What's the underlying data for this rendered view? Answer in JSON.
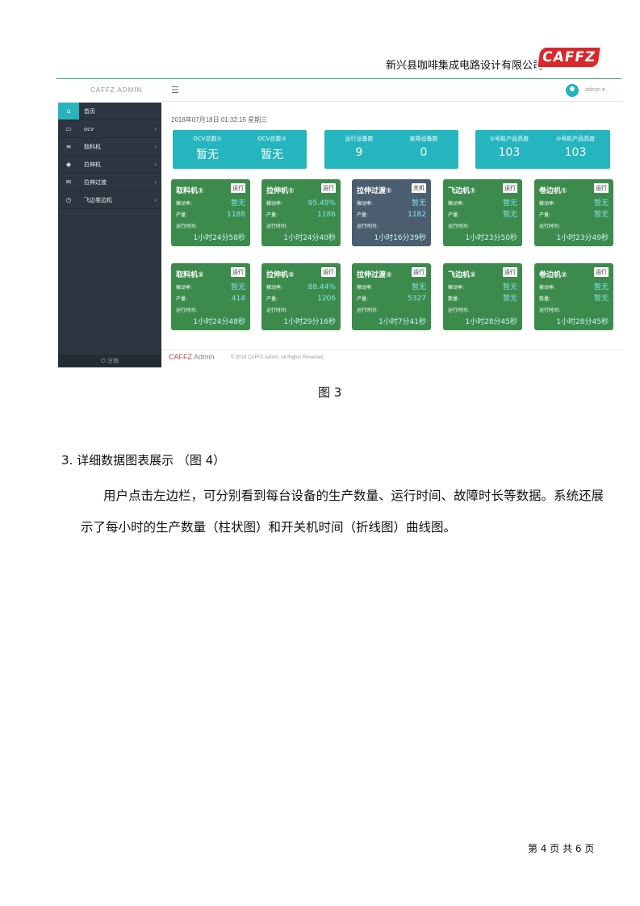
{
  "header": {
    "company": "新兴县咖啡集成电路设计有限公司",
    "logo_text": "CAFFZ"
  },
  "screenshot": {
    "brand": "CAFFZ ADMIN",
    "user": "admin ▾",
    "nav": [
      {
        "label": "首页",
        "icon": "home-icon",
        "active": true
      },
      {
        "label": "ocv",
        "icon": "monitor-icon"
      },
      {
        "label": "取料机",
        "icon": "list-icon"
      },
      {
        "label": "拉伸机",
        "icon": "tag-icon"
      },
      {
        "label": "拉伸过渡",
        "icon": "mail-icon"
      },
      {
        "label": "飞边卷边机",
        "icon": "clock-icon"
      }
    ],
    "logout": "⏻ 注销",
    "datetime": "2018年07月18日 01:32:15 星期三",
    "stats": [
      {
        "items": [
          {
            "label": "OCV总数①",
            "value": "暂无"
          },
          {
            "label": "OCV总数②",
            "value": "暂无"
          }
        ]
      },
      {
        "items": [
          {
            "label": "运行设备数",
            "value": "9"
          },
          {
            "label": "故障设备数",
            "value": "0"
          }
        ]
      },
      {
        "items": [
          {
            "label": "①号机产品高度",
            "value": "103"
          },
          {
            "label": "②号机产品高度",
            "value": "103"
          }
        ]
      }
    ],
    "devices": [
      {
        "name": "取料机①",
        "status": "运行",
        "rows": [
          {
            "k": "稼动率:",
            "v": "暂无"
          },
          {
            "k": "产量:",
            "v": "1188"
          },
          {
            "k": "运行时间:",
            "v": ""
          }
        ],
        "runtime": "1小时24分58秒"
      },
      {
        "name": "拉伸机①",
        "status": "运行",
        "rows": [
          {
            "k": "稼动率:",
            "v": "95.49%"
          },
          {
            "k": "产量:",
            "v": "1186"
          },
          {
            "k": "运行时间:",
            "v": ""
          }
        ],
        "runtime": "1小时24分40秒"
      },
      {
        "name": "拉伸过渡①",
        "status": "关机",
        "rows": [
          {
            "k": "稼动率:",
            "v": "暂无"
          },
          {
            "k": "产量:",
            "v": "1182"
          },
          {
            "k": "运行时间:",
            "v": ""
          }
        ],
        "runtime": "1小时16分39秒"
      },
      {
        "name": "飞边机①",
        "status": "运行",
        "rows": [
          {
            "k": "稼动率:",
            "v": "暂无"
          },
          {
            "k": "产量:",
            "v": "暂无"
          },
          {
            "k": "运行时间:",
            "v": ""
          }
        ],
        "runtime": "1小时23分50秒"
      },
      {
        "name": "卷边机①",
        "status": "运行",
        "rows": [
          {
            "k": "稼动率:",
            "v": "暂无"
          },
          {
            "k": "产量:",
            "v": "暂无"
          },
          {
            "k": "运行时间:",
            "v": ""
          }
        ],
        "runtime": "1小时23分49秒"
      },
      {
        "name": "取料机②",
        "status": "运行",
        "rows": [
          {
            "k": "稼动率:",
            "v": "暂无"
          },
          {
            "k": "产量:",
            "v": "414"
          },
          {
            "k": "运行时间:",
            "v": ""
          }
        ],
        "runtime": "1小时24分48秒"
      },
      {
        "name": "拉伸机②",
        "status": "运行",
        "rows": [
          {
            "k": "稼动率:",
            "v": "88.44%"
          },
          {
            "k": "产量:",
            "v": "1206"
          },
          {
            "k": "运行时间:",
            "v": ""
          }
        ],
        "runtime": "1小时29分16秒"
      },
      {
        "name": "拉伸过渡②",
        "status": "运行",
        "rows": [
          {
            "k": "稼动率:",
            "v": "暂无"
          },
          {
            "k": "产量:",
            "v": "5327"
          },
          {
            "k": "运行时间:",
            "v": ""
          }
        ],
        "runtime": "1小时7分41秒"
      },
      {
        "name": "飞边机②",
        "status": "运行",
        "rows": [
          {
            "k": "稼动率:",
            "v": "暂无"
          },
          {
            "k": "数量:",
            "v": "暂无"
          },
          {
            "k": "运行时间:",
            "v": ""
          }
        ],
        "runtime": "1小时28分45秒"
      },
      {
        "name": "卷边机②",
        "status": "运行",
        "rows": [
          {
            "k": "稼动率:",
            "v": "暂无"
          },
          {
            "k": "数量:",
            "v": "暂无"
          },
          {
            "k": "运行时间:",
            "v": ""
          }
        ],
        "runtime": "1小时28分45秒"
      }
    ],
    "footer_brand_a": "CAFFZ",
    "footer_brand_b": " Admin",
    "footer_copy": "© 2018 CAFFZ Admin. All Rights Reserved"
  },
  "document": {
    "figure_caption": "图 3",
    "section_heading": "3. 详细数据图表展示 （图 4）",
    "body": "用户点击左边栏，可分别看到每台设备的生产数量、运行时间、故障时长等数据。系统还展示了每小时的生产数量（柱状图）和开关机时间（折线图）曲线图。",
    "page_footer": "第 4 页 共 6 页"
  },
  "colors": {
    "accent": "#25b5be",
    "card_running": "#3d8b4c",
    "card_off": "#4b5e70",
    "sidebar": "#2b3640",
    "logo": "#d8282c"
  }
}
